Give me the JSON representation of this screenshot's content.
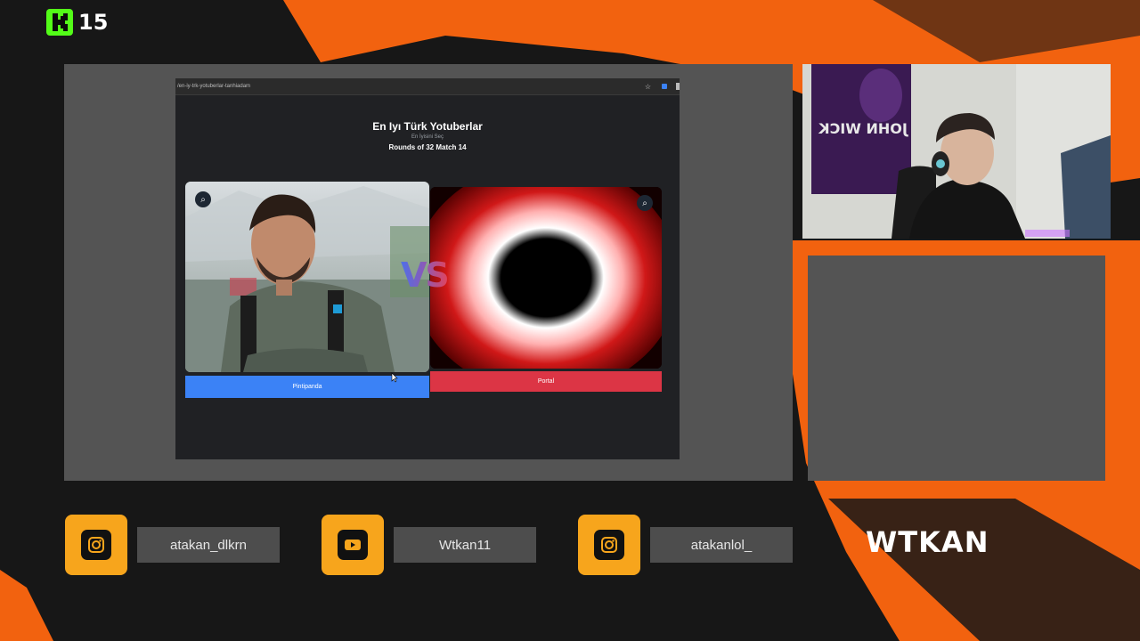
{
  "overlay": {
    "kick_follower_count": "15",
    "brand_name": "WTKAN",
    "colors": {
      "accent_orange": "#f2620f",
      "social_yellow": "#f7a51c",
      "kick_green": "#53fc18",
      "panel_gray": "#545454"
    },
    "socials": [
      {
        "icon": "instagram-icon",
        "label": "atakan_dlkrn"
      },
      {
        "icon": "youtube-icon",
        "label": "Wtkan11"
      },
      {
        "icon": "instagram-icon",
        "label": "atakanlol_"
      }
    ]
  },
  "browser": {
    "url": "/en-iy-trk-yotuberlar-tanhiadam"
  },
  "game": {
    "title": "En Iyı Türk Yotuberlar",
    "subtitle": "En İyisini Seç",
    "round_info": "Rounds of 32 Match 14",
    "vs_label": "VS",
    "left_option": {
      "name": "Pintipanda",
      "color": "#3b82f6"
    },
    "right_option": {
      "name": "Portal",
      "color": "#dc3545"
    }
  },
  "webcam": {
    "poster_text": "JOHN WICK"
  }
}
